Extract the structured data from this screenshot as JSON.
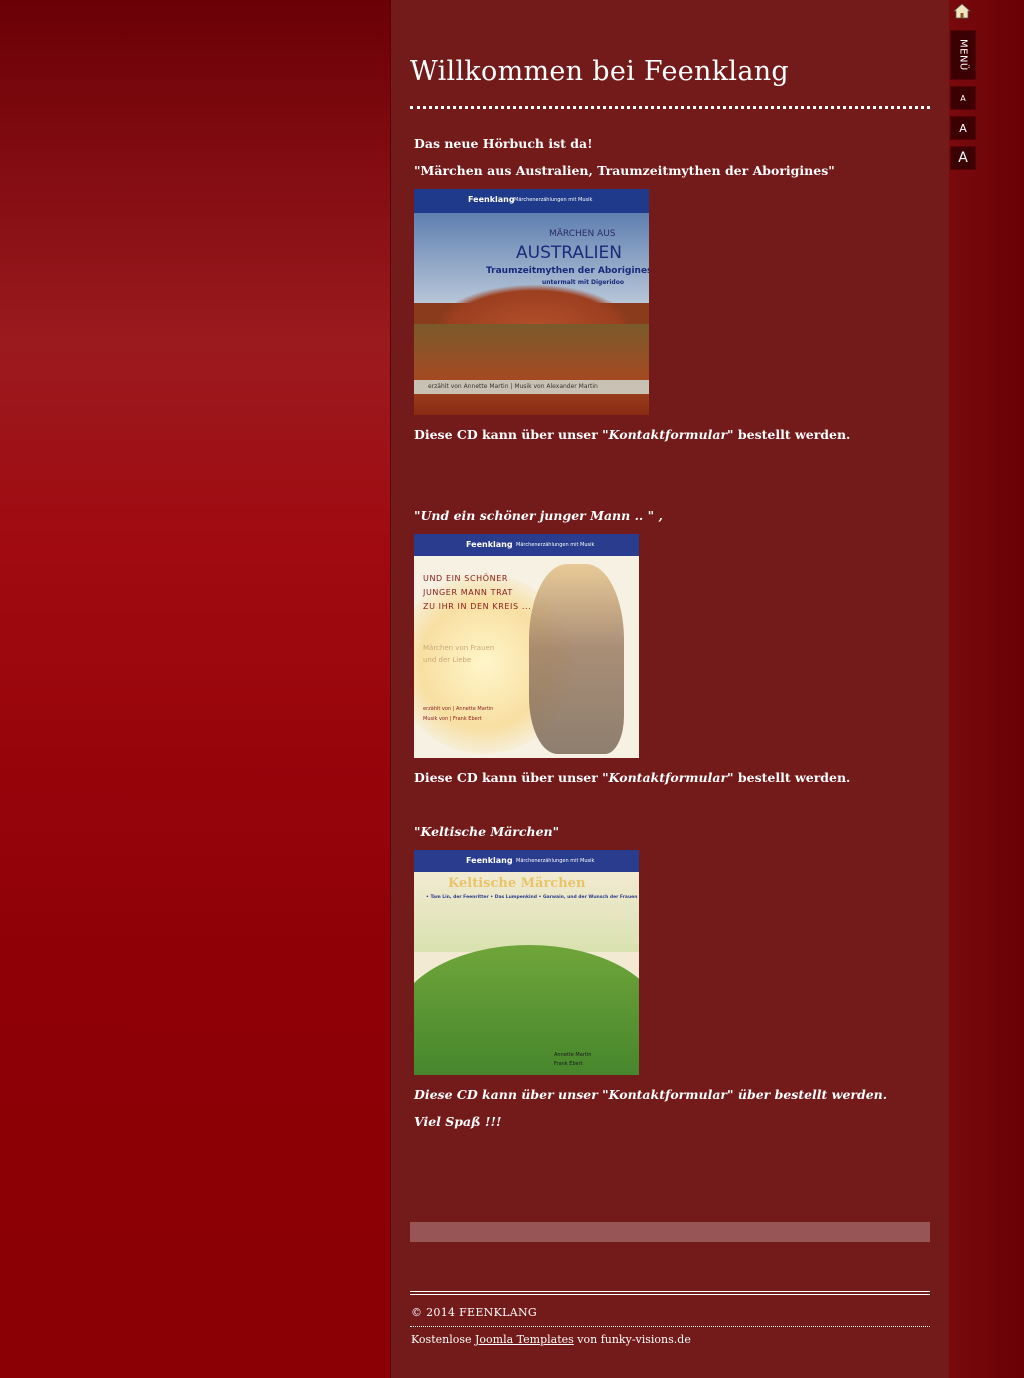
{
  "page": {
    "title": "Willkommen bei Feenklang"
  },
  "sidebar": {
    "home_icon": "home-icon",
    "menu_label": "MENÜ",
    "font_small": "A",
    "font_medium": "A",
    "font_large": "A"
  },
  "article": {
    "intro": "Das neue Hörbuch ist da!",
    "book1_title": "\"Märchen aus Australien, Traumzeitmythen der Aborigines\"",
    "book1_order": {
      "prefix": "Diese CD kann über unser ",
      "link": "\"Kontaktformular\"",
      "suffix": "  bestellt werden."
    },
    "book2_title": "\"Und ein schöner junger Mann .. \" ,",
    "book2_order": {
      "prefix": "Diese CD kann über unser ",
      "link": "\"Kontaktformular\"",
      "suffix": "  bestellt werden."
    },
    "book3_title": "\"Keltische Märchen\"",
    "book3_order": "Diese CD kann über unser \"Kontaktformular\" über bestellt werden.",
    "closing": "Viel Spaß !!!"
  },
  "covers": {
    "cover1": {
      "brand": "Feenklang",
      "sub": "Märchenerzählungen mit Musik",
      "line1": "MÄRCHEN AUS",
      "line2": "AUSTRALIEN",
      "line3": "Traumzeitmythen der Aborigines",
      "line4": "untermalt mit Digeridoo",
      "credits": "erzählt von Annette Martin | Musik von Alexander Martin"
    },
    "cover2": {
      "brand": "Feenklang",
      "sub": "Märchenerzählungen mit Musik",
      "line1": "UND EIN SCHÖNER",
      "line2": "JUNGER MANN TRAT",
      "line3": "ZU IHR IN DEN KREIS ...",
      "subtitle1": "Märchen von Frauen",
      "subtitle2": "und der Liebe",
      "credit1": "erzählt von  |  Annette Martin",
      "credit2": "Musik von  |  Frank Ebert"
    },
    "cover3": {
      "brand": "Feenklang",
      "sub": "Märchenerzählungen mit Musik",
      "title": "Keltische Märchen",
      "tagline": "• Tam Lin, der Feenritter • Das Lumpenkind • Garwain, und der Wunsch der Frauen",
      "credit1": "Annette Martin",
      "credit2": "Frank Ebert"
    }
  },
  "footer": {
    "copyright": "© 2014 FEENKLANG",
    "credit_prefix": "Kostenlose ",
    "credit_link": "Joomla Templates",
    "credit_suffix": " von funky-visions.de"
  }
}
